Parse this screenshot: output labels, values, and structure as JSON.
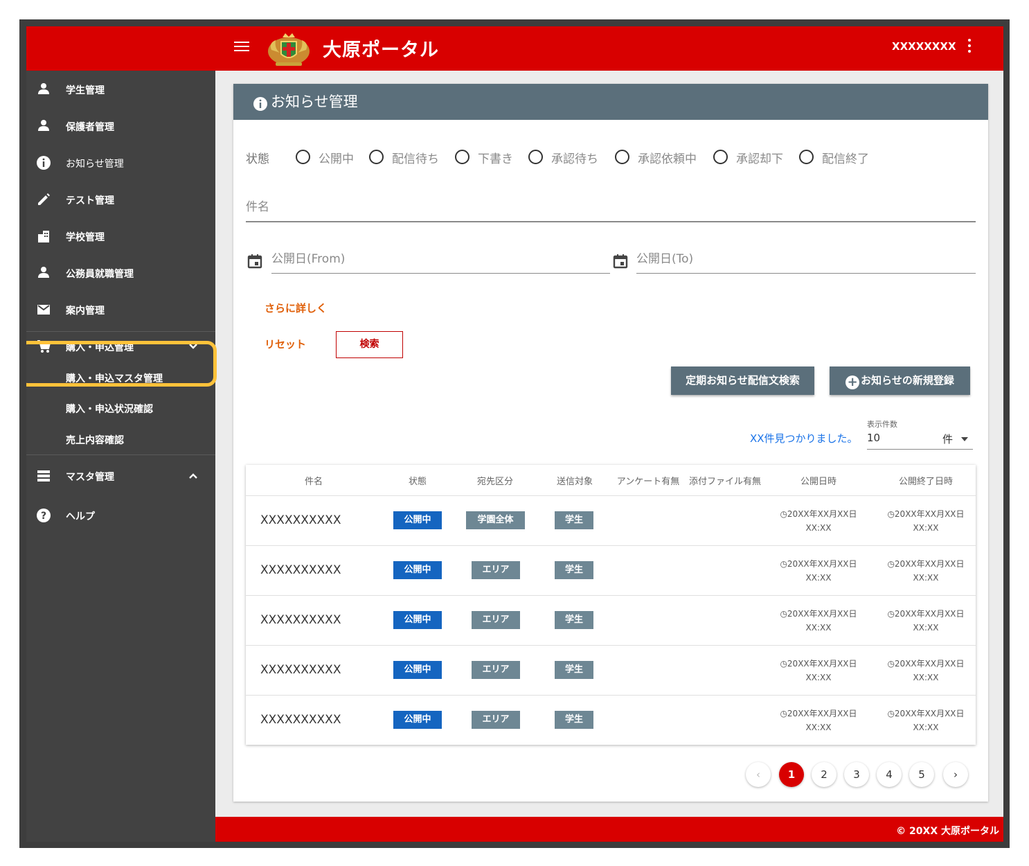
{
  "header": {
    "title": "大原ポータル",
    "user": "XXXXXXXX"
  },
  "sidebar": {
    "items": [
      {
        "label": "学生管理"
      },
      {
        "label": "保護者管理"
      },
      {
        "label": "お知らせ管理"
      },
      {
        "label": "テスト管理"
      },
      {
        "label": "学校管理"
      },
      {
        "label": "公務員就職管理"
      },
      {
        "label": "案内管理"
      },
      {
        "label": "購入・申込管理"
      },
      {
        "label": "マスタ管理"
      },
      {
        "label": "ヘルプ"
      }
    ],
    "sub_items": [
      {
        "label": "購入・申込マスタ管理"
      },
      {
        "label": "購入・申込状況確認"
      },
      {
        "label": "売上内容確認"
      }
    ],
    "highlight_color": "#ffc23a"
  },
  "page": {
    "title": "お知らせ管理"
  },
  "filters": {
    "status_label": "状態",
    "status_options": [
      "公開中",
      "配信待ち",
      "下書き",
      "承認待ち",
      "承認依頼中",
      "承認却下",
      "配信終了"
    ],
    "subject_placeholder": "件名",
    "date_from_placeholder": "公開日(From)",
    "date_to_placeholder": "公開日(To)",
    "more_link": "さらに詳しく",
    "reset_label": "リセット",
    "search_label": "検索"
  },
  "actions": {
    "periodic_search": "定期お知らせ配信文検索",
    "new_register": "お知らせの新規登録"
  },
  "results": {
    "found_text": "XX件見つかりました。",
    "per_page_label": "表示件数",
    "per_page_value": "10",
    "per_page_unit": "件"
  },
  "table": {
    "columns": [
      "件名",
      "状態",
      "宛先区分",
      "送信対象",
      "アンケート有無",
      "添付ファイル有無",
      "公開日時",
      "公開終了日時"
    ],
    "rows": [
      {
        "name": "XXXXXXXXXX",
        "status": "公開中",
        "dest": "学園全体",
        "target": "学生",
        "publish": "◷20XX年XX月XX日",
        "publish_time": "XX:XX",
        "end": "◷20XX年XX月XX日",
        "end_time": "XX:XX"
      },
      {
        "name": "XXXXXXXXXX",
        "status": "公開中",
        "dest": "エリア",
        "target": "学生",
        "publish": "◷20XX年XX月XX日",
        "publish_time": "XX:XX",
        "end": "◷20XX年XX月XX日",
        "end_time": "XX:XX"
      },
      {
        "name": "XXXXXXXXXX",
        "status": "公開中",
        "dest": "エリア",
        "target": "学生",
        "publish": "◷20XX年XX月XX日",
        "publish_time": "XX:XX",
        "end": "◷20XX年XX月XX日",
        "end_time": "XX:XX"
      },
      {
        "name": "XXXXXXXXXX",
        "status": "公開中",
        "dest": "エリア",
        "target": "学生",
        "publish": "◷20XX年XX月XX日",
        "publish_time": "XX:XX",
        "end": "◷20XX年XX月XX日",
        "end_time": "XX:XX"
      },
      {
        "name": "XXXXXXXXXX",
        "status": "公開中",
        "dest": "エリア",
        "target": "学生",
        "publish": "◷20XX年XX月XX日",
        "publish_time": "XX:XX",
        "end": "◷20XX年XX月XX日",
        "end_time": "XX:XX"
      }
    ]
  },
  "pagination": {
    "pages": [
      "1",
      "2",
      "3",
      "4",
      "5"
    ],
    "current": "1",
    "prev": "‹",
    "next": "›"
  },
  "footer": {
    "copyright": "© 20XX 大原ポータル"
  },
  "colors": {
    "brand": "#d80000",
    "header_bar": "#5b6f7b",
    "sidebar": "#424242",
    "link": "#e0600a",
    "status_blue": "#1565c0"
  }
}
